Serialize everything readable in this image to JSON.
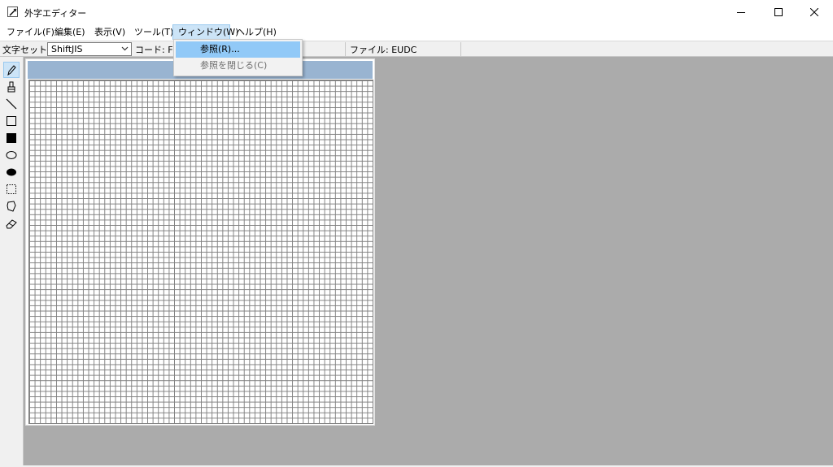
{
  "window": {
    "title": "外字エディター"
  },
  "menu": [
    {
      "label": "ファイル(F)"
    },
    {
      "label": "編集(E)"
    },
    {
      "label": "表示(V)"
    },
    {
      "label": "ツール(T)"
    },
    {
      "label": "ウィンドウ(W)"
    },
    {
      "label": "ヘルプ(H)"
    }
  ],
  "toolbar": {
    "charset_label": "文字セット:",
    "charset_value": "ShiftJIS",
    "code_label": "コード: F04",
    "file_label": "ファイル: EUDC"
  },
  "window_menu": {
    "items": [
      {
        "label": "参照(R)..."
      },
      {
        "label": "参照を閉じる(C)"
      }
    ]
  },
  "tools": [
    {
      "icon": "pencil-icon"
    },
    {
      "icon": "brush-icon"
    },
    {
      "icon": "line-icon"
    },
    {
      "icon": "hollow-rectangle-icon"
    },
    {
      "icon": "filled-rectangle-icon"
    },
    {
      "icon": "hollow-ellipse-icon"
    },
    {
      "icon": "filled-ellipse-icon"
    },
    {
      "icon": "rectangle-select-icon"
    },
    {
      "icon": "freeform-select-icon"
    },
    {
      "icon": "eraser-icon"
    }
  ],
  "colors": {
    "workspace": "#ababab",
    "edit_caption": "#99b4d1",
    "menu_highlight": "#91c9f7"
  }
}
